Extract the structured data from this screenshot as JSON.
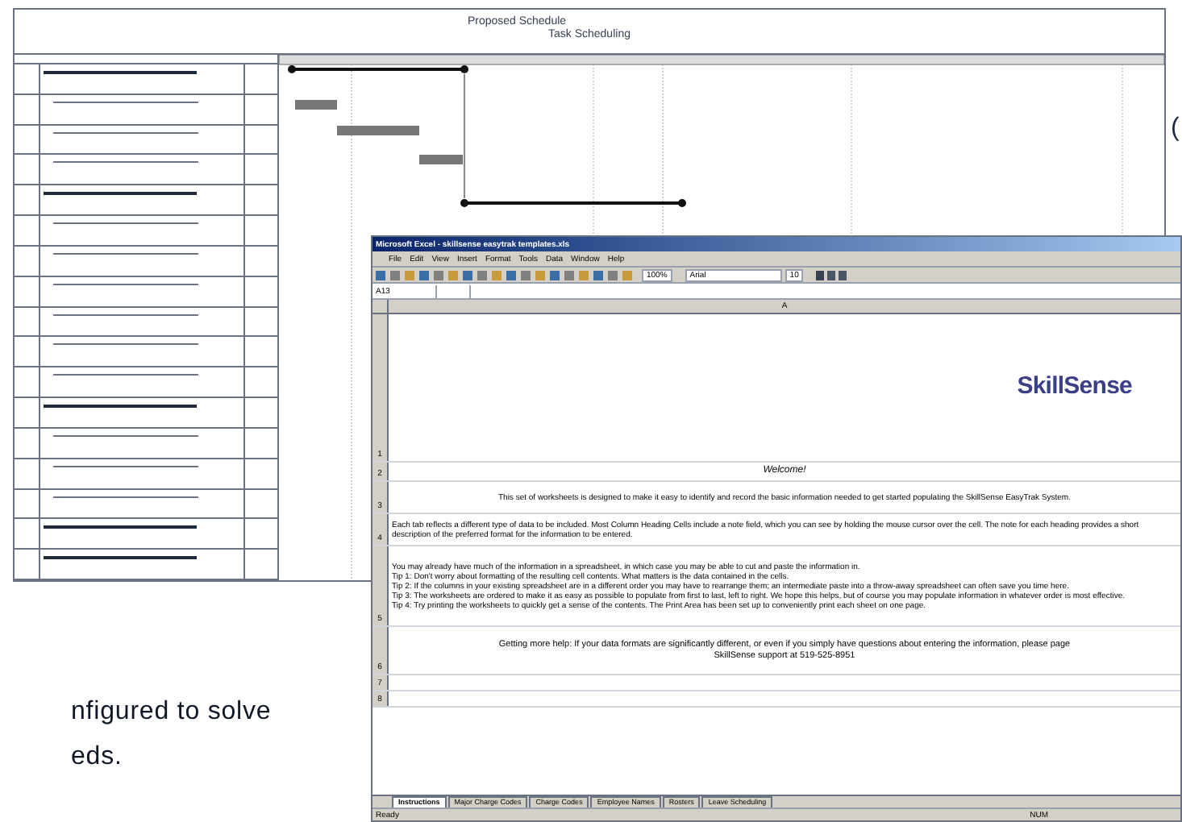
{
  "gantt": {
    "title": "Proposed Schedule",
    "subtitle": "Task Scheduling",
    "rows": [
      {
        "kind": "summary"
      },
      {
        "kind": "task"
      },
      {
        "kind": "task"
      },
      {
        "kind": "task"
      },
      {
        "kind": "summary"
      },
      {
        "kind": "task"
      },
      {
        "kind": "task"
      },
      {
        "kind": "task"
      },
      {
        "kind": "task"
      },
      {
        "kind": "task"
      },
      {
        "kind": "task"
      },
      {
        "kind": "summary"
      },
      {
        "kind": "task"
      },
      {
        "kind": "task"
      },
      {
        "kind": "task"
      },
      {
        "kind": "summary"
      },
      {
        "kind": "summary"
      }
    ]
  },
  "page_text": {
    "edge_glyph": "(",
    "lines": [
      "nfigured to solve",
      "eds."
    ]
  },
  "excel": {
    "title": "Microsoft Excel - skillsense easytrak templates.xls",
    "menu": [
      "File",
      "Edit",
      "View",
      "Insert",
      "Format",
      "Tools",
      "Data",
      "Window",
      "Help"
    ],
    "zoom": "100%",
    "font": "Arial",
    "size": "10",
    "cell_ref": "A13",
    "column": "A",
    "logo": "SkillSense",
    "rows": [
      {
        "num": "1",
        "kind": "logo"
      },
      {
        "num": "2",
        "kind": "title",
        "text": "Welcome!"
      },
      {
        "num": "3",
        "kind": "center",
        "text": "This set of worksheets is designed to make it easy to identify and record the basic information needed to get started populating the SkillSense EasyTrak System."
      },
      {
        "num": "4",
        "kind": "left",
        "text": "Each tab reflects a different type of data to be included. Most Column Heading Cells include a note field, which you can see by holding the mouse cursor over the cell. The note for each heading provides a short description of the preferred format for the information to be entered."
      },
      {
        "num": "5",
        "kind": "tips",
        "lines": [
          "You may already have much of the information in a spreadsheet, in which case you may be able to cut and paste the information in.",
          "Tip 1: Don't worry about formatting of the resulting cell contents. What matters is the data contained in the cells.",
          "Tip 2: If the columns in your existing spreadsheet are in a different order you may have to rearrange them; an intermediate paste into a throw-away spreadsheet can often save you time here.",
          "Tip 3: The worksheets are ordered to make it as easy as possible to populate from first to last, left to right. We hope this helps, but of course you may populate information in whatever order is most effective.",
          "Tip 4: Try printing the worksheets to quickly get a sense of the contents. The Print Area has been set up to conveniently print each sheet on one page."
        ]
      },
      {
        "num": "6",
        "kind": "help",
        "lines": [
          "Getting more help: If your data formats are significantly different, or even if you simply have questions about entering the information, please page",
          "SkillSense support at 519-525-8951"
        ]
      },
      {
        "num": "7",
        "kind": "empty"
      },
      {
        "num": "8",
        "kind": "empty"
      }
    ],
    "sheets": [
      {
        "label": "Instructions",
        "selected": true
      },
      {
        "label": "Major Charge Codes",
        "selected": false
      },
      {
        "label": "Charge Codes",
        "selected": false
      },
      {
        "label": "Employee Names",
        "selected": false
      },
      {
        "label": "Rosters",
        "selected": false
      },
      {
        "label": "Leave Scheduling",
        "selected": false
      }
    ],
    "status": "Ready",
    "status_right": "NUM"
  }
}
